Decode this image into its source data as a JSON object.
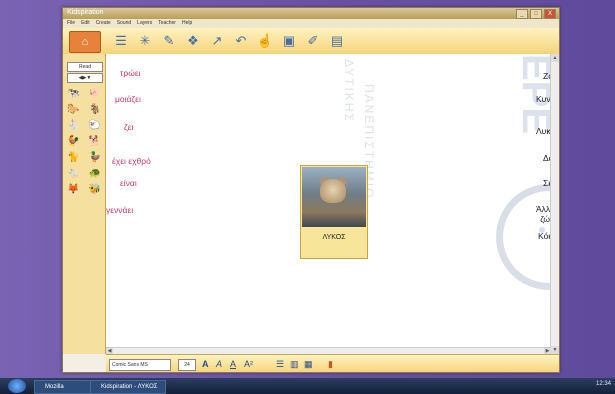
{
  "window": {
    "title": "Kidspiration",
    "menu": [
      "File",
      "Edit",
      "Create",
      "Sound",
      "Layers",
      "Teacher",
      "Help"
    ],
    "controls": {
      "minimize": "_",
      "maximize": "□",
      "close": "X"
    }
  },
  "toolbar": {
    "home_icon": "home-icon",
    "tools": [
      "list-view-icon",
      "star-icon",
      "wand-icon",
      "group-icon",
      "arrow-link-icon",
      "undo-icon",
      "hand-icon",
      "picture-icon",
      "pen-icon",
      "note-icon"
    ]
  },
  "sidebar": {
    "read_label": "Read",
    "items": [
      "▦",
      "▦",
      "▦",
      "▦",
      "▦",
      "▦",
      "▦",
      "▦",
      "▦"
    ]
  },
  "canvas": {
    "verbs": [
      "τρώει",
      "μοιάζει",
      "ζει",
      "έχει εχθρό",
      "είναι",
      "γεννάει"
    ],
    "nouns": [
      "Ζώα",
      "Κυνηγό",
      "Λυκάκια",
      "Δάσος",
      "Σκυλί",
      "Άλλα ζώα",
      "Κόκκαλα"
    ],
    "card": {
      "label": "ΛΥΚΟΣ"
    },
    "watermark_1": "ΔΥΤΙΚΗΣ",
    "watermark_2": "ΠΑΝΕΠΙΣΤΗΜΙΟ",
    "watermark_big": "ΕΡΕ"
  },
  "bottombar": {
    "font_value": "Comic Sans MS",
    "size_value": "24",
    "format_buttons": [
      "A",
      "A",
      "A",
      "A²"
    ]
  },
  "taskbar": {
    "tasks": [
      "Mozilla",
      "Kidspiration - ΛΥΚΟΣ"
    ],
    "tray_time": "12:34"
  },
  "colors": {
    "verb": "#c23a6a",
    "noun": "#1a1a30",
    "toolbar": "#f5d37a",
    "card": "#f7e59a",
    "desktop": "#6d56a6"
  }
}
